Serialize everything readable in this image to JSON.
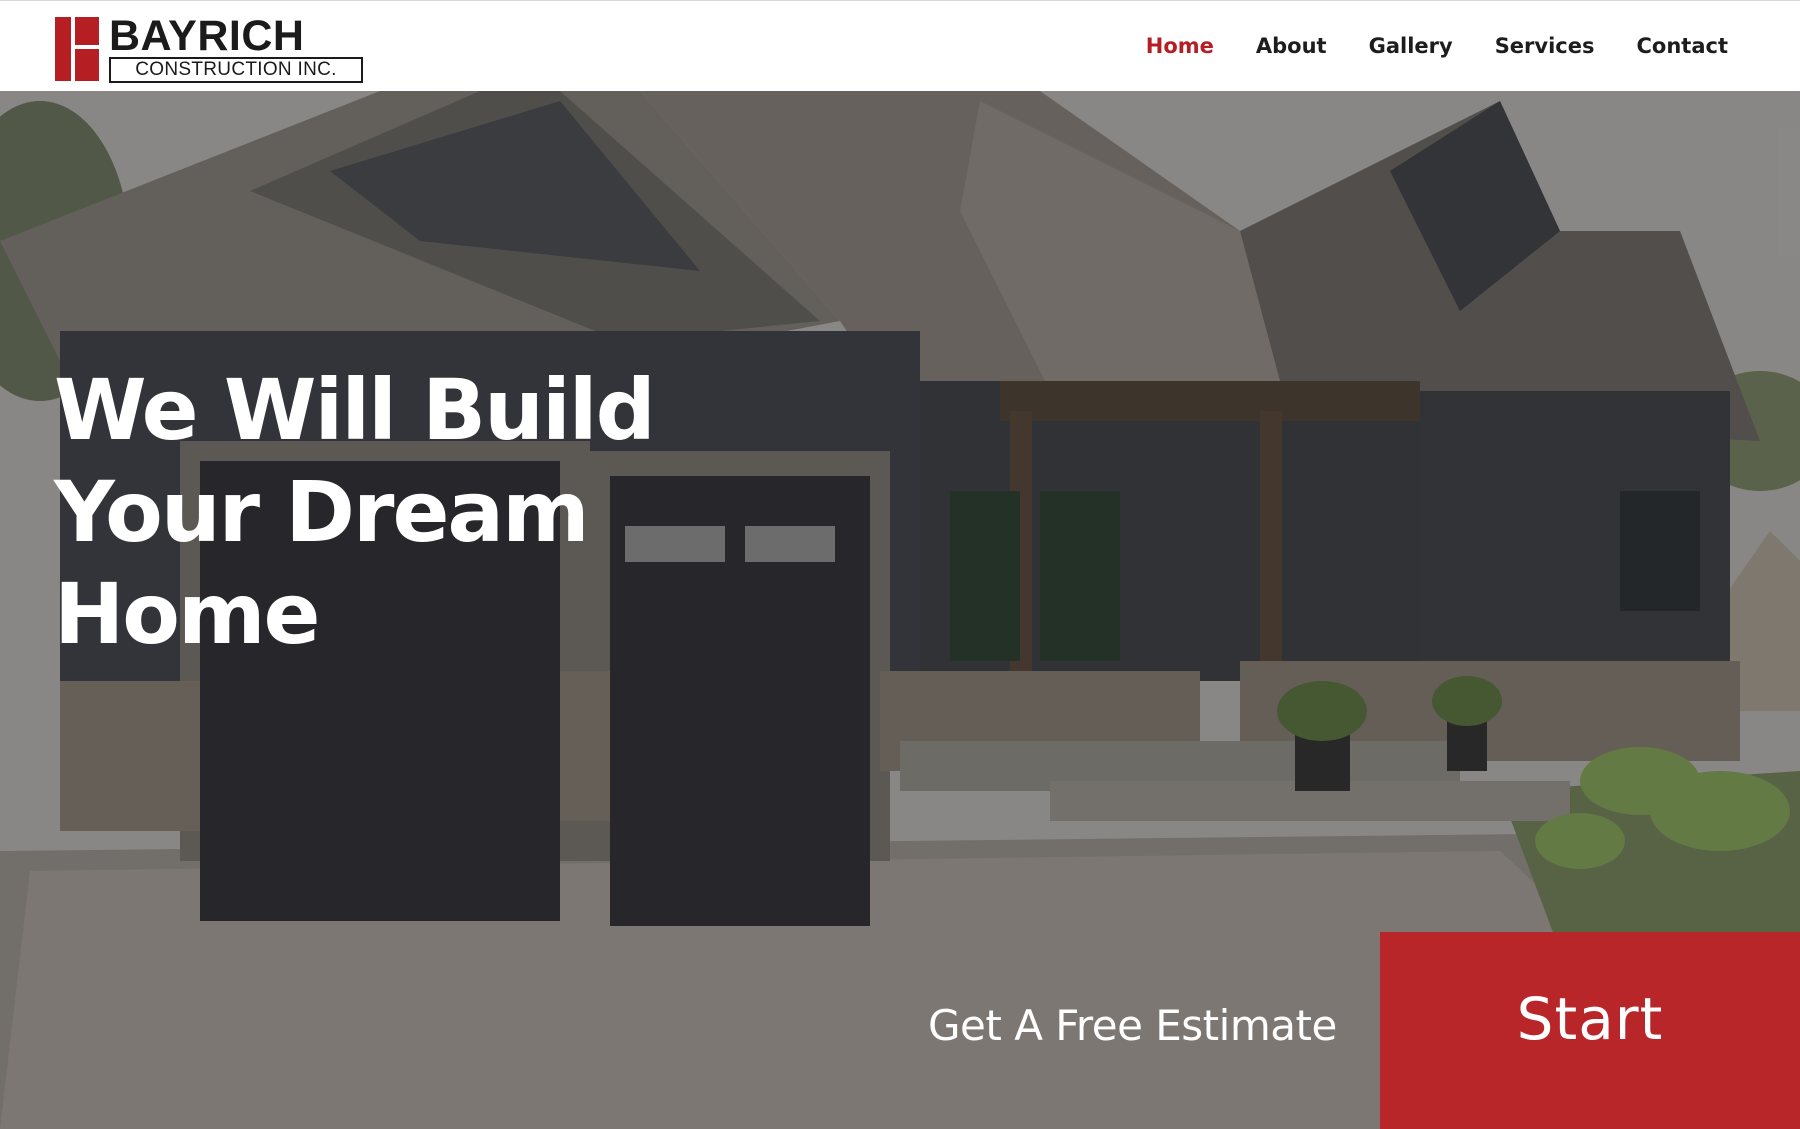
{
  "brand": {
    "name": "BAYRICH",
    "subtitle": "CONSTRUCTION INC.",
    "color": "#b51f24"
  },
  "nav": {
    "items": [
      {
        "label": "Home",
        "active": true
      },
      {
        "label": "About",
        "active": false
      },
      {
        "label": "Gallery",
        "active": false
      },
      {
        "label": "Services",
        "active": false
      },
      {
        "label": "Contact",
        "active": false
      }
    ]
  },
  "hero": {
    "headline_lines": [
      "We Will Build",
      "Your Dream",
      "Home"
    ],
    "cta_text": "Get A Free Estimate",
    "cta_button": "Start",
    "cta_color": "#b8262a"
  }
}
